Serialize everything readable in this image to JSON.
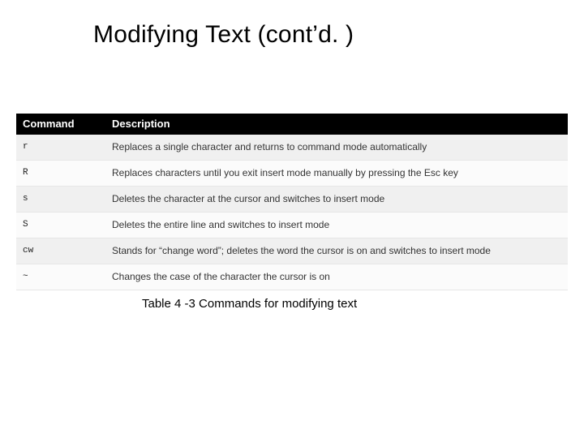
{
  "title": "Modifying Text (cont’d. )",
  "table": {
    "headers": {
      "command": "Command",
      "description": "Description"
    },
    "rows": [
      {
        "command": "r",
        "description": "Replaces a single character and returns to command mode automatically"
      },
      {
        "command": "R",
        "description": "Replaces characters until you exit insert mode manually by pressing the Esc key"
      },
      {
        "command": "s",
        "description": "Deletes the character at the cursor and switches to insert mode"
      },
      {
        "command": "S",
        "description": "Deletes the entire line and switches to insert mode"
      },
      {
        "command": "cw",
        "description": "Stands for “change word”; deletes the word the cursor is on and switches to insert mode"
      },
      {
        "command": "~",
        "description": "Changes the case of the character the cursor is on"
      }
    ]
  },
  "caption": "Table 4 -3 Commands for modifying text"
}
